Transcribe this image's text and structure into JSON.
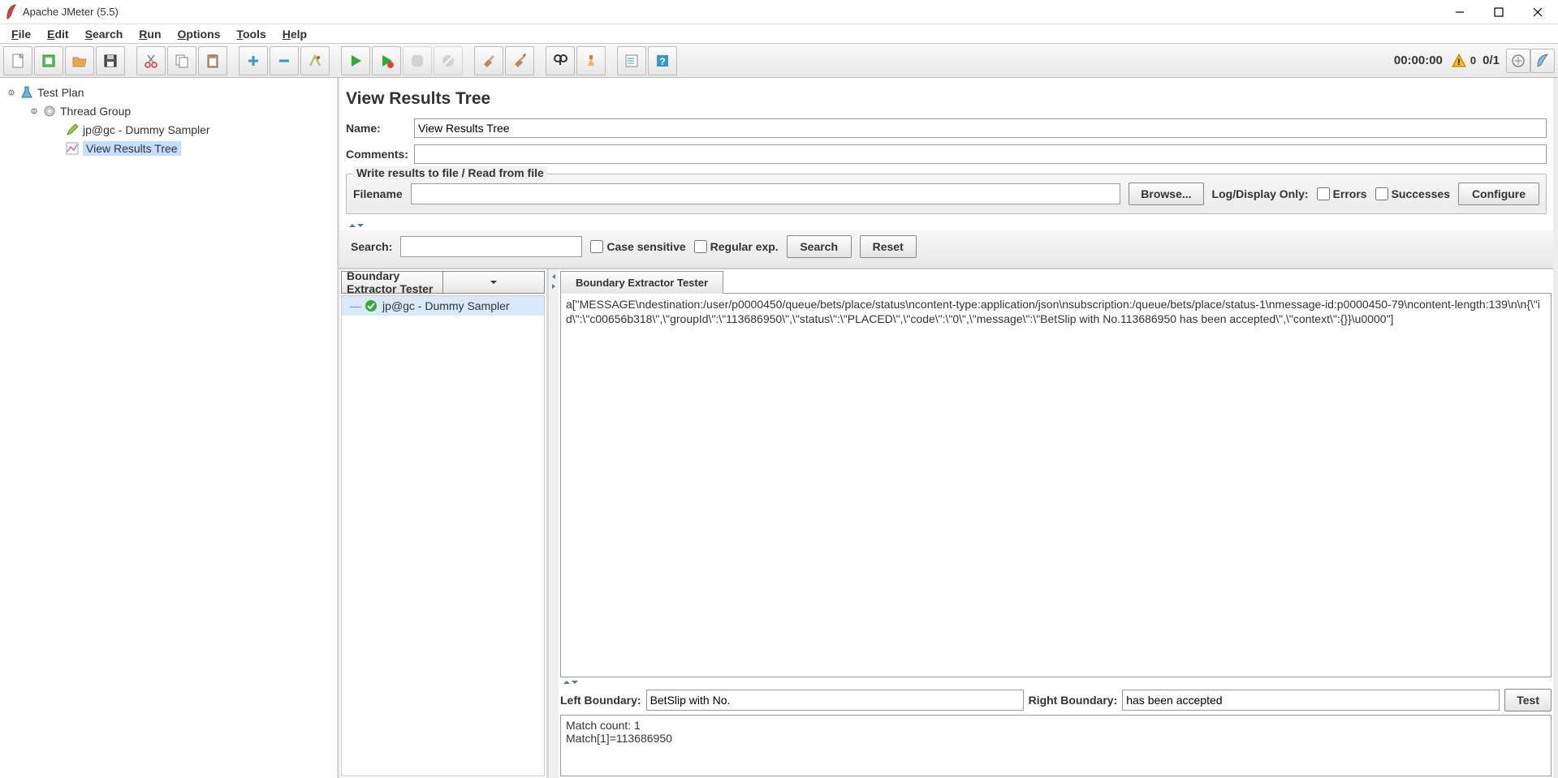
{
  "window": {
    "title": "Apache JMeter (5.5)"
  },
  "menu": {
    "file": "File",
    "edit": "Edit",
    "search": "Search",
    "run": "Run",
    "options": "Options",
    "tools": "Tools",
    "help": "Help"
  },
  "toolbar_status": {
    "time": "00:00:00",
    "warn_count": "0",
    "threads": "0/1"
  },
  "tree": {
    "test_plan": "Test Plan",
    "thread_group": "Thread Group",
    "dummy_sampler": "jp@gc - Dummy Sampler",
    "view_results": "View Results Tree"
  },
  "panel": {
    "title": "View Results Tree",
    "name_label": "Name:",
    "name_value": "View Results Tree",
    "comments_label": "Comments:",
    "comments_value": ""
  },
  "fileset": {
    "legend": "Write results to file / Read from file",
    "filename_label": "Filename",
    "filename_value": "",
    "browse": "Browse...",
    "logdisplay": "Log/Display Only:",
    "errors": "Errors",
    "successes": "Successes",
    "configure": "Configure"
  },
  "search_bar": {
    "label": "Search:",
    "value": "",
    "case": "Case sensitive",
    "regex": "Regular exp.",
    "search_btn": "Search",
    "reset_btn": "Reset"
  },
  "results": {
    "renderer": "Boundary Extractor Tester",
    "sample_name": "jp@gc - Dummy Sampler",
    "tab": "Boundary Extractor Tester",
    "body": "a[\"MESSAGE\\ndestination:/user/p0000450/queue/bets/place/status\\ncontent-type:application/json\\nsubscription:/queue/bets/place/status-1\\nmessage-id:p0000450-79\\ncontent-length:139\\n\\n{\\\"id\\\":\\\"c00656b318\\\",\\\"groupId\\\":\\\"113686950\\\",\\\"status\\\":\\\"PLACED\\\",\\\"code\\\":\\\"0\\\",\\\"message\\\":\\\"BetSlip with No.113686950 has been accepted\\\",\\\"context\\\":{}}\\u0000\"]",
    "left_label": "Left Boundary:",
    "left_value": "BetSlip with No.",
    "right_label": "Right Boundary:",
    "right_value": "has been accepted",
    "test_btn": "Test",
    "match_output": "Match count: 1\nMatch[1]=113686950"
  }
}
